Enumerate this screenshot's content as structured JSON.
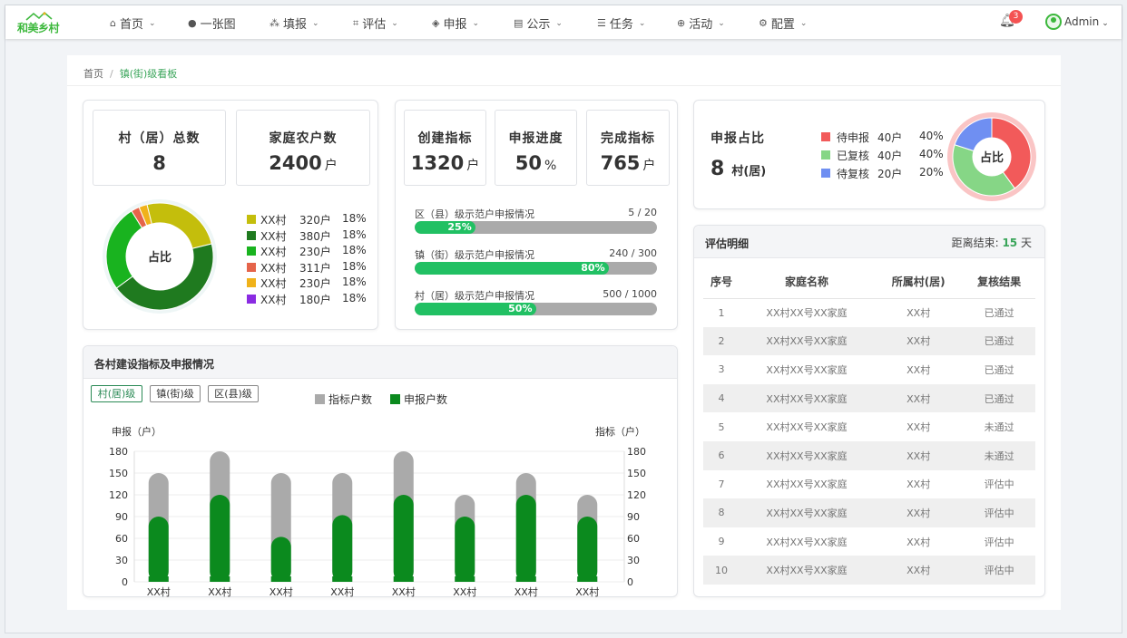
{
  "app": {
    "logo_text": "和美乡村"
  },
  "nav": [
    {
      "label": "首页",
      "icon": "home-icon",
      "glyph": "⌂",
      "chevron": true
    },
    {
      "label": "一张图",
      "icon": "globe-icon",
      "glyph": "●",
      "chevron": false
    },
    {
      "label": "填报",
      "icon": "cluster-icon",
      "glyph": "⁂",
      "chevron": true
    },
    {
      "label": "评估",
      "icon": "frame-icon",
      "glyph": "⌗",
      "chevron": true
    },
    {
      "label": "申报",
      "icon": "layers-icon",
      "glyph": "◈",
      "chevron": true
    },
    {
      "label": "公示",
      "icon": "board-icon",
      "glyph": "▤",
      "chevron": true
    },
    {
      "label": "任务",
      "icon": "tasks-icon",
      "glyph": "☰",
      "chevron": true
    },
    {
      "label": "活动",
      "icon": "lifebuoy-icon",
      "glyph": "⊕",
      "chevron": true
    },
    {
      "label": "配置",
      "icon": "gear-icon",
      "glyph": "⚙",
      "chevron": true
    }
  ],
  "header": {
    "notification_count": "3",
    "user_name": "Admin"
  },
  "breadcrumb": {
    "home": "首页",
    "separator": "/",
    "current": "镇(街)级看板"
  },
  "stats_left": {
    "villages": {
      "label": "村（居）总数",
      "value": "8"
    },
    "households": {
      "label": "家庭农户数",
      "value": "2400",
      "unit": "户"
    }
  },
  "village_share": {
    "center_label": "占比",
    "items": [
      {
        "name": "XX村",
        "count": "320户",
        "pct": "18%",
        "color": "#c4be0c",
        "share": 0.2
      },
      {
        "name": "XX村",
        "count": "380户",
        "pct": "18%",
        "color": "#1f7a1f",
        "share": 0.35
      },
      {
        "name": "XX村",
        "count": "230户",
        "pct": "18%",
        "color": "#19b31f",
        "share": 0.21
      },
      {
        "name": "XX村",
        "count": "311户",
        "pct": "18%",
        "color": "#e5644a",
        "share": 0.02
      },
      {
        "name": "XX村",
        "count": "230户",
        "pct": "18%",
        "color": "#f0b21a",
        "share": 0.02
      },
      {
        "name": "XX村",
        "count": "180户",
        "pct": "18%",
        "color": "#8a2be2",
        "share": 0.0
      }
    ]
  },
  "stats_mid": {
    "created": {
      "label": "创建指标",
      "value": "1320",
      "unit": "户"
    },
    "progress": {
      "label": "申报进度",
      "value": "50",
      "unit": "%"
    },
    "completed": {
      "label": "完成指标",
      "value": "765",
      "unit": "户"
    }
  },
  "progress_bars": [
    {
      "title": "区（县）级示范户申报情况",
      "ratio": "5 / 20",
      "percent_label": "25%",
      "percent": 25
    },
    {
      "title": "镇（街）级示范户申报情况",
      "ratio": "240 / 300",
      "percent_label": "80%",
      "percent": 80
    },
    {
      "title": "村（居）级示范户申报情况",
      "ratio": "500 / 1000",
      "percent_label": "50%",
      "percent": 50
    }
  ],
  "declare_ratio": {
    "title": "申报占比",
    "value": "8",
    "unit": "村(居)",
    "center_label": "占比",
    "items": [
      {
        "name": "待申报",
        "count": "40户",
        "pct": "40%",
        "color": "#f25a5a",
        "share": 0.4
      },
      {
        "name": "已复核",
        "count": "40户",
        "pct": "40%",
        "color": "#86d686",
        "share": 0.4
      },
      {
        "name": "待复核",
        "count": "20户",
        "pct": "20%",
        "color": "#6f8ff2",
        "share": 0.2
      }
    ]
  },
  "bar_panel": {
    "title": "各村建设指标及申报情况",
    "tabs": [
      "村(居)级",
      "镇(街)级",
      "区(县)级"
    ],
    "active_tab": 0
  },
  "chart_data": {
    "type": "bar",
    "categories": [
      "XX村",
      "XX村",
      "XX村",
      "XX村",
      "XX村",
      "XX村",
      "XX村",
      "XX村"
    ],
    "series": [
      {
        "name": "指标户数",
        "color": "#aaaaaa",
        "values": [
          150,
          180,
          150,
          150,
          180,
          120,
          150,
          120
        ]
      },
      {
        "name": "申报户数",
        "color": "#0b8a1e",
        "values": [
          90,
          120,
          62,
          92,
          120,
          90,
          120,
          90
        ]
      }
    ],
    "ylabel_left": "申报（户）",
    "ylabel_right": "指标（户）",
    "yticks": [
      "180",
      "150",
      "120",
      "90",
      "60",
      "30",
      "0"
    ],
    "ylim": [
      0,
      180
    ],
    "grid": true,
    "legend_position": "top-center"
  },
  "detail_panel": {
    "title": "评估明细",
    "countdown_label": "距离结束:",
    "countdown_value": "15",
    "countdown_unit": "天",
    "columns": [
      "序号",
      "家庭名称",
      "所属村(居)",
      "复核结果"
    ],
    "rows": [
      [
        "1",
        "XX村XX号XX家庭",
        "XX村",
        "已通过"
      ],
      [
        "2",
        "XX村XX号XX家庭",
        "XX村",
        "已通过"
      ],
      [
        "3",
        "XX村XX号XX家庭",
        "XX村",
        "已通过"
      ],
      [
        "4",
        "XX村XX号XX家庭",
        "XX村",
        "已通过"
      ],
      [
        "5",
        "XX村XX号XX家庭",
        "XX村",
        "未通过"
      ],
      [
        "6",
        "XX村XX号XX家庭",
        "XX村",
        "未通过"
      ],
      [
        "7",
        "XX村XX号XX家庭",
        "XX村",
        "评估中"
      ],
      [
        "8",
        "XX村XX号XX家庭",
        "XX村",
        "评估中"
      ],
      [
        "9",
        "XX村XX号XX家庭",
        "XX村",
        "评估中"
      ],
      [
        "10",
        "XX村XX号XX家庭",
        "XX村",
        "评估中"
      ]
    ]
  }
}
